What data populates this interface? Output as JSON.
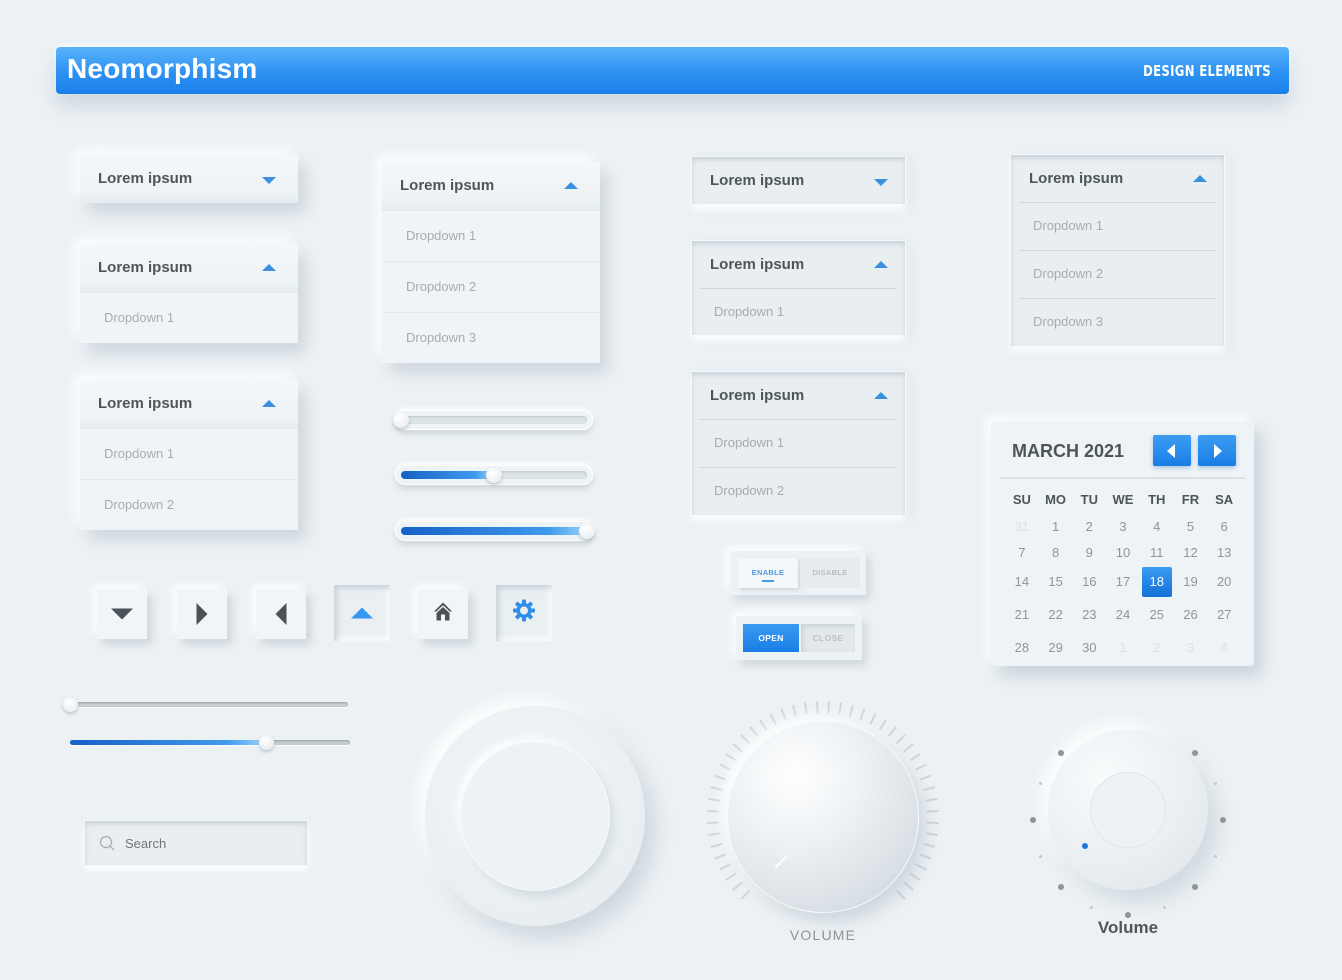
{
  "header": {
    "title": "Neomorphism",
    "subtitle": "DESIGN ELEMENTS"
  },
  "dropdowns": {
    "d1": {
      "label": "Lorem ipsum",
      "state": "collapsed",
      "items": []
    },
    "d2": {
      "label": "Lorem ipsum",
      "state": "expanded",
      "items": [
        "Dropdown 1"
      ]
    },
    "d3": {
      "label": "Lorem ipsum",
      "state": "expanded",
      "items": [
        "Dropdown 1",
        "Dropdown 2"
      ]
    },
    "d4": {
      "label": "Lorem ipsum",
      "state": "expanded",
      "items": [
        "Dropdown 1",
        "Dropdown 2",
        "Dropdown 3"
      ]
    },
    "d5": {
      "label": "Lorem ipsum",
      "state": "collapsed",
      "items": []
    },
    "d6": {
      "label": "Lorem ipsum",
      "state": "expanded",
      "items": [
        "Dropdown 1"
      ]
    },
    "d7": {
      "label": "Lorem ipsum",
      "state": "expanded",
      "items": [
        "Dropdown 1",
        "Dropdown 2"
      ]
    },
    "d8": {
      "label": "Lorem ipsum",
      "state": "expanded",
      "items": [
        "Dropdown 1",
        "Dropdown 2",
        "Dropdown 3"
      ]
    }
  },
  "sliders": {
    "rail_sliders": [
      {
        "name": "slider-1",
        "value_pct": 0
      },
      {
        "name": "slider-2",
        "value_pct": 50
      },
      {
        "name": "slider-3",
        "value_pct": 100
      }
    ],
    "thin_sliders": [
      {
        "name": "thin-slider-1",
        "value_pct": 0
      },
      {
        "name": "thin-slider-2",
        "value_pct": 70
      }
    ]
  },
  "icon_buttons": [
    {
      "icon": "caret-down-icon",
      "pressed": false
    },
    {
      "icon": "caret-right-icon",
      "pressed": false
    },
    {
      "icon": "caret-left-icon",
      "pressed": false
    },
    {
      "icon": "caret-up-icon",
      "pressed": true
    },
    {
      "icon": "home-icon",
      "pressed": false
    },
    {
      "icon": "gear-icon",
      "pressed": true
    }
  ],
  "toggles": {
    "enable_disable": {
      "options": [
        "ENABLE",
        "DISABLE"
      ],
      "selected": "ENABLE"
    },
    "open_close": {
      "options": [
        "OPEN",
        "CLOSE"
      ],
      "selected": "OPEN"
    }
  },
  "search": {
    "placeholder": "Search",
    "value": ""
  },
  "calendar": {
    "title": "MARCH 2021",
    "weekdays": [
      "SU",
      "MO",
      "TU",
      "WE",
      "TH",
      "FR",
      "SA"
    ],
    "weeks": [
      [
        "31",
        "1",
        "2",
        "3",
        "4",
        "5",
        "6"
      ],
      [
        "7",
        "8",
        "9",
        "10",
        "11",
        "12",
        "13"
      ],
      [
        "14",
        "15",
        "16",
        "17",
        "18",
        "19",
        "20"
      ],
      [
        "21",
        "22",
        "23",
        "24",
        "25",
        "26",
        "27"
      ],
      [
        "28",
        "29",
        "30",
        "1",
        "2",
        "3",
        "4"
      ]
    ],
    "muted": [
      [
        0,
        0
      ],
      [
        4,
        3
      ],
      [
        4,
        4
      ],
      [
        4,
        5
      ],
      [
        4,
        6
      ]
    ],
    "selected": "18",
    "accent": "#1f86ec"
  },
  "knobs": {
    "volume_ticks": {
      "label": "VOLUME"
    },
    "volume_dots": {
      "label": "Volume",
      "level_step": 1
    }
  },
  "colors": {
    "accent": "#2d91f2",
    "background": "#ecf1f4",
    "text_dark": "#4e565b",
    "text_muted": "#a6acb0"
  }
}
